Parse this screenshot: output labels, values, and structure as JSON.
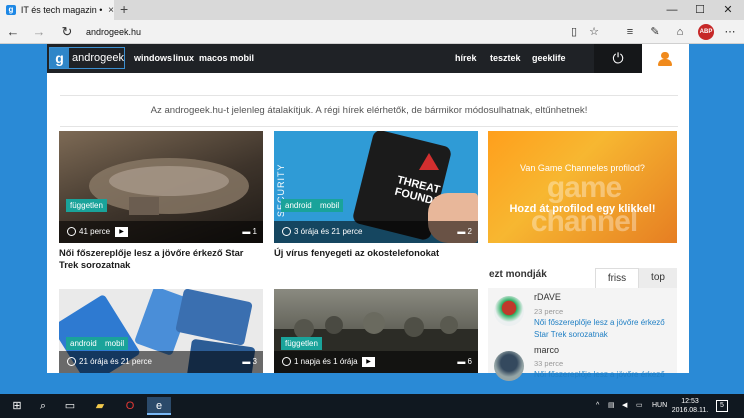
{
  "browser": {
    "tab_title": "IT és tech magazin • and",
    "tab_close": "×",
    "new_tab": "+",
    "address": "androgeek.hu",
    "abp_label": "ABP",
    "controls": {
      "minimize": "—",
      "maximize": "☐",
      "close": "✕"
    }
  },
  "site": {
    "logo_g": "g",
    "logo_text": "androgeek",
    "nav_left": [
      "windows",
      "linux",
      "macos",
      "mobil"
    ],
    "nav_right": [
      "hírek",
      "tesztek",
      "geeklife"
    ],
    "notice": "Az androgeek.hu-t jelenleg átalakítjuk. A régi hírek elérhetők, de bármikor módosulhatnak, eltűnhetnek!"
  },
  "articles": [
    {
      "badges": [
        "független"
      ],
      "time": "41 perce",
      "comments": "1",
      "title": "Női főszereplője lesz a jövőre érkező Star Trek sorozatnak",
      "thumb_color": "#5a4a3a"
    },
    {
      "badges": [
        "android",
        "mobil"
      ],
      "time": "3 órája és 21 perce",
      "comments": "2",
      "title": "Új vírus fenyegeti az okostelefonokat",
      "thumb_color": "#2f9bd6",
      "thumb_text_1": "THREAT",
      "thumb_text_2": "FOUND!",
      "side_text": "SECURITY"
    },
    {
      "badges": [
        "android",
        "mobil"
      ],
      "time": "21 órája és 21 perce",
      "comments": "3",
      "title": "",
      "thumb_color": "#dcdcdc"
    },
    {
      "badges": [
        "független"
      ],
      "time": "1 napja és 1 órája",
      "comments": "6",
      "title": "",
      "thumb_color": "#4a4a42"
    }
  ],
  "ad": {
    "question": "Van Game Channeles profilod?",
    "logo": "game channel",
    "cta": "Hozd át profilod egy klikkel!"
  },
  "comments_box": {
    "title": "ezt mondják",
    "tabs": [
      "friss",
      "top"
    ],
    "items": [
      {
        "user": "rDAVE",
        "time": "23 perce",
        "text": "Női főszereplője lesz a jövőre érkező Star Trek sorozatnak"
      },
      {
        "user": "marco",
        "time": "33 perce",
        "text": "Női főszereplője lesz a jövőre érkező"
      }
    ]
  },
  "taskbar": {
    "lang": "HUN",
    "time": "12:53",
    "date": "2016.08.11.",
    "notif_count": "5"
  }
}
